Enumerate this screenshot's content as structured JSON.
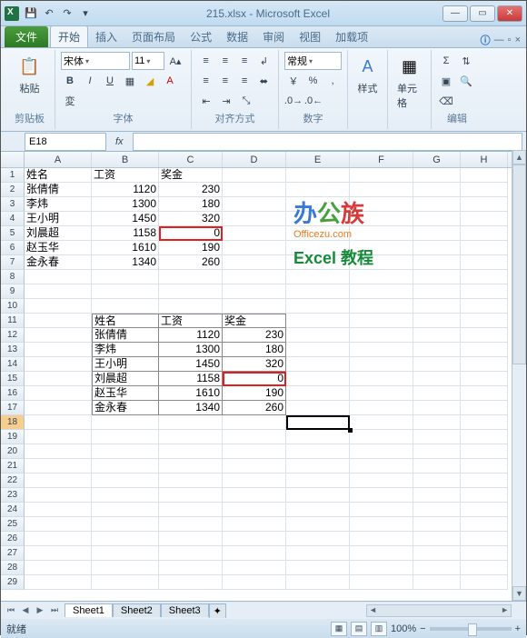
{
  "window": {
    "title": "215.xlsx - Microsoft Excel"
  },
  "ribbon_tabs": {
    "file": "文件",
    "home": "开始",
    "insert": "插入",
    "page_layout": "页面布局",
    "formulas": "公式",
    "data": "数据",
    "review": "审阅",
    "view": "视图",
    "addins": "加载项"
  },
  "ribbon": {
    "clipboard": {
      "label": "剪贴板",
      "paste": "粘贴"
    },
    "font": {
      "label": "字体",
      "name": "宋体",
      "size": "11"
    },
    "alignment": {
      "label": "对齐方式",
      "wrap": "常规"
    },
    "number": {
      "label": "数字"
    },
    "styles": {
      "label": "样式"
    },
    "cells": {
      "label": "单元格"
    },
    "editing": {
      "label": "编辑"
    }
  },
  "formula_bar": {
    "name_box": "E18",
    "fx": "fx",
    "formula": ""
  },
  "columns": [
    "A",
    "B",
    "C",
    "D",
    "E",
    "F",
    "G",
    "H"
  ],
  "rows_visible": 29,
  "active_row": 18,
  "chart_data": {
    "type": "table",
    "tables": [
      {
        "range": "A1:C7",
        "headers": [
          "姓名",
          "工资",
          "奖金"
        ],
        "rows": [
          [
            "张倩倩",
            1120,
            230
          ],
          [
            "李炜",
            1300,
            180
          ],
          [
            "王小明",
            1450,
            320
          ],
          [
            "刘晨超",
            1158,
            0
          ],
          [
            "赵玉华",
            1610,
            190
          ],
          [
            "金永春",
            1340,
            260
          ]
        ]
      },
      {
        "range": "B10:D17",
        "headers": [
          "姓名",
          "工资",
          "奖金"
        ],
        "rows": [
          [
            "张倩倩",
            1120,
            230
          ],
          [
            "李炜",
            1300,
            180
          ],
          [
            "王小明",
            1450,
            320
          ],
          [
            "刘晨超",
            1158,
            0
          ],
          [
            "赵玉华",
            1610,
            190
          ],
          [
            "金永春",
            1340,
            260
          ]
        ]
      }
    ]
  },
  "cells": {
    "t1": {
      "A1": "姓名",
      "B1": "工资",
      "C1": "奖金",
      "A2": "张倩倩",
      "B2": "1120",
      "C2": "230",
      "A3": "李炜",
      "B3": "1300",
      "C3": "180",
      "A4": "王小明",
      "B4": "1450",
      "C4": "320",
      "A5": "刘晨超",
      "B5": "1158",
      "C5": "0",
      "A6": "赵玉华",
      "B6": "1610",
      "C6": "190",
      "A7": "金永春",
      "B7": "1340",
      "C7": "260"
    },
    "t2": {
      "B11": "姓名",
      "C11": "工资",
      "D11": "奖金",
      "B12": "张倩倩",
      "C12": "1120",
      "D12": "230",
      "B13": "李炜",
      "C13": "1300",
      "D13": "180",
      "B14": "王小明",
      "C14": "1450",
      "D14": "320",
      "B15": "刘晨超",
      "C15": "1158",
      "D15": "0",
      "B16": "赵玉华",
      "C16": "1610",
      "D16": "190",
      "B17": "金永春",
      "C17": "1340",
      "D17": "260"
    }
  },
  "watermark": {
    "office_cn": "办公族",
    "office_url": "Officezu.com",
    "excel_tutorial": "Excel 教程"
  },
  "sheets": {
    "s1": "Sheet1",
    "s2": "Sheet2",
    "s3": "Sheet3"
  },
  "status": {
    "ready": "就绪",
    "zoom": "100%"
  }
}
